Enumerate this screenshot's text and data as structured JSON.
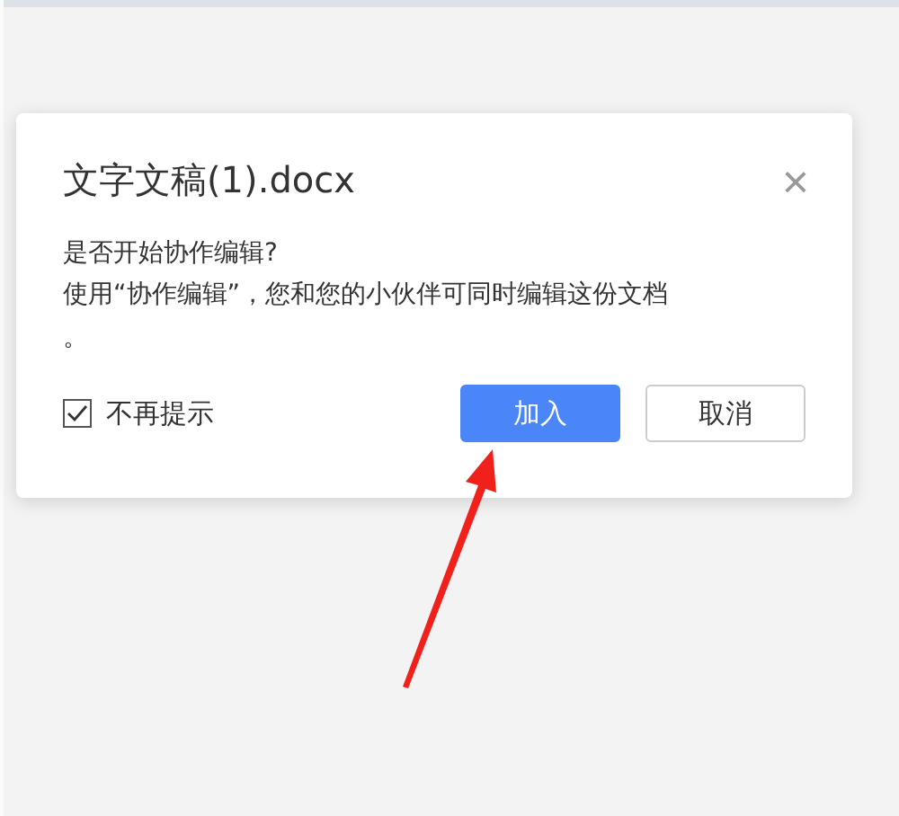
{
  "dialog": {
    "title": "文字文稿(1).docx",
    "close": "×",
    "question": "是否开始协作编辑?",
    "message": "使用“协作编辑”，您和您的小伙伴可同时编辑这份文档。",
    "dont_show_again": {
      "label": "不再提示",
      "checked": true
    },
    "buttons": [
      {
        "label": "加入",
        "kind": "primary"
      },
      {
        "label": "取消",
        "kind": "secondary"
      }
    ]
  }
}
